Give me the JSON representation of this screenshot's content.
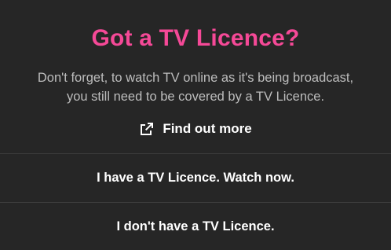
{
  "dialog": {
    "title": "Got a TV Licence?",
    "message_line1": "Don't forget, to watch TV online as it's being broadcast,",
    "message_line2": "you still need to be covered by a TV Licence.",
    "find_out_label": "Find out more",
    "find_out_icon": "external-link-icon",
    "have_licence_label": "I have a TV Licence. Watch now.",
    "no_licence_label": "I don't have a TV Licence."
  },
  "colors": {
    "title": "#f54997",
    "background": "#262626",
    "message_text": "#bdbdbd",
    "divider": "#3d3d3d"
  }
}
